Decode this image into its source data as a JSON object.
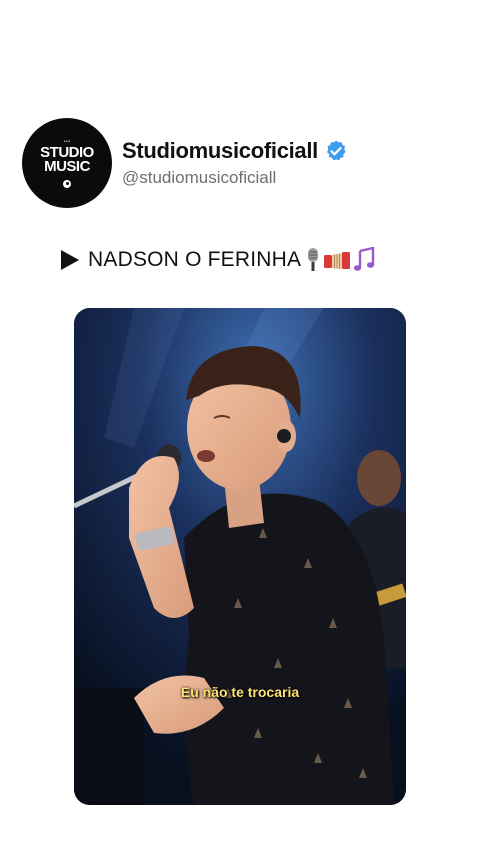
{
  "profile": {
    "avatar_text": [
      "STUDIO",
      "MUSIC"
    ],
    "display_name": "Studiomusicoficiall",
    "handle": "@studiomusicoficiall",
    "verified": true,
    "verified_color": "#3d9bf0"
  },
  "post": {
    "caption": "NADSON O FERINHA",
    "caption_icons": [
      "play-icon",
      "microphone-icon",
      "accordion-icon",
      "music-notes-icon"
    ],
    "video_subtitle": "Eu não te trocaria"
  }
}
